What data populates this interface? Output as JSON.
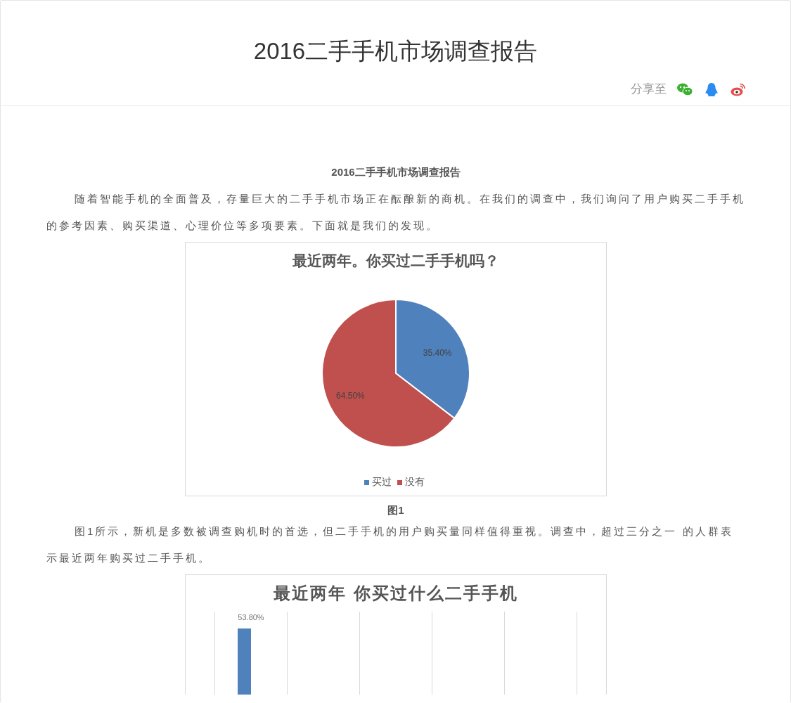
{
  "header": {
    "title": "2016二手手机市场调查报告",
    "share_label": "分享至"
  },
  "article": {
    "subtitle": "2016二手手机市场调查报告",
    "paragraph_1": "随着智能手机的全面普及，存量巨大的二手手机市场正在酝酿新的商机。在我们的调查中，我们询问了用户购买二手手机的参考因素、购买渠道、心理价位等多项要素。下面就是我们的发现。",
    "figure_1": {
      "chart_data": {
        "type": "pie",
        "title": "最近两年。你买过二手手机吗？",
        "categories": [
          "买过",
          "没有"
        ],
        "values": [
          35.4,
          64.5
        ],
        "value_labels": [
          "35.40%",
          "64.50%"
        ],
        "colors": [
          "#4f81bd",
          "#c0504d"
        ],
        "legend": "bottom"
      },
      "caption": "图1"
    },
    "paragraph_2": "图1所示，新机是多数被调查购机时的首选，但二手手机的用户购买量同样值得重视。调查中，超过三分之一 的人群表示最近两年购买过二手手机。",
    "figure_2": {
      "title": "最近两年 你买过什么二手手机",
      "bar_label": "53.80%"
    }
  }
}
